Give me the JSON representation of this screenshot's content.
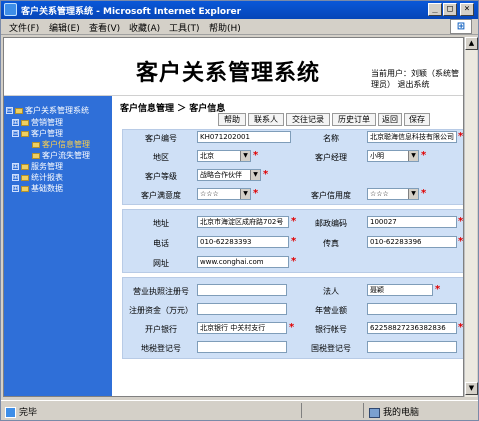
{
  "window": {
    "title": "客户关系管理系统 - Microsoft Internet Explorer",
    "buttons": {
      "minimize": "_",
      "maximize": "□",
      "close": "×"
    }
  },
  "menu": [
    "文件(F)",
    "编辑(E)",
    "查看(V)",
    "收藏(A)",
    "工具(T)",
    "帮助(H)"
  ],
  "header": {
    "system_title": "客户关系管理系统",
    "user_text": "当前用户：刘颖（系统管理员）",
    "logout": "退出系统"
  },
  "sidebar": {
    "items": [
      {
        "label": "客户关系管理系统",
        "toggle": "⊟",
        "level": 0
      },
      {
        "label": "营销管理",
        "toggle": "⊞",
        "level": 1
      },
      {
        "label": "客户管理",
        "toggle": "⊟",
        "level": 1
      },
      {
        "label": "客户信息管理",
        "toggle": "",
        "level": 2,
        "selected": true
      },
      {
        "label": "客户流失管理",
        "toggle": "",
        "level": 2
      },
      {
        "label": "服务管理",
        "toggle": "⊞",
        "level": 1
      },
      {
        "label": "统计报表",
        "toggle": "⊞",
        "level": 1
      },
      {
        "label": "基础数据",
        "toggle": "⊞",
        "level": 1
      }
    ]
  },
  "breadcrumb": "客户信息管理 ＞ 客户信息",
  "toolbar": {
    "help": "帮助",
    "contacts": "联系人",
    "interaction": "交往记录",
    "history_orders": "历史订单",
    "back": "返回",
    "save": "保存"
  },
  "form": {
    "customer_no": {
      "label": "客户编号",
      "value": "KH071202001"
    },
    "name": {
      "label": "名称",
      "value": "北京聪海信息科技有限公司"
    },
    "region": {
      "label": "地区",
      "value": "北京"
    },
    "manager": {
      "label": "客户经理",
      "value": "小明"
    },
    "level": {
      "label": "客户等级",
      "value": "战略合作伙伴"
    },
    "satisfaction": {
      "label": "客户满意度",
      "value": "☆☆☆"
    },
    "credit": {
      "label": "客户信用度",
      "value": "☆☆☆"
    },
    "address": {
      "label": "地址",
      "value": "北京市海淀区成府路702号"
    },
    "postcode": {
      "label": "邮政编码",
      "value": "100027"
    },
    "phone": {
      "label": "电话",
      "value": "010-62283393"
    },
    "fax": {
      "label": "传真",
      "value": "010-62283396"
    },
    "website": {
      "label": "网址",
      "value": "www.conghai.com"
    },
    "license_no": {
      "label": "营业执照注册号",
      "value": ""
    },
    "legal_person": {
      "label": "法人",
      "value": "聂颖"
    },
    "capital": {
      "label": "注册资金（万元）",
      "value": ""
    },
    "turnover": {
      "label": "年营业额",
      "value": ""
    },
    "bank": {
      "label": "开户银行",
      "value": "北京银行 中关村支行"
    },
    "bank_account": {
      "label": "银行帐号",
      "value": "62258827236382836"
    },
    "local_tax": {
      "label": "地税登记号",
      "value": ""
    },
    "national_tax": {
      "label": "国税登记号",
      "value": ""
    }
  },
  "statusbar": {
    "left": "完毕",
    "right": "我的电脑"
  },
  "colors": {
    "titlebar": "#0a58d8",
    "sidebar": "#2f6fd8",
    "form_bg": "#cfe0f6",
    "required": "#e00000"
  }
}
